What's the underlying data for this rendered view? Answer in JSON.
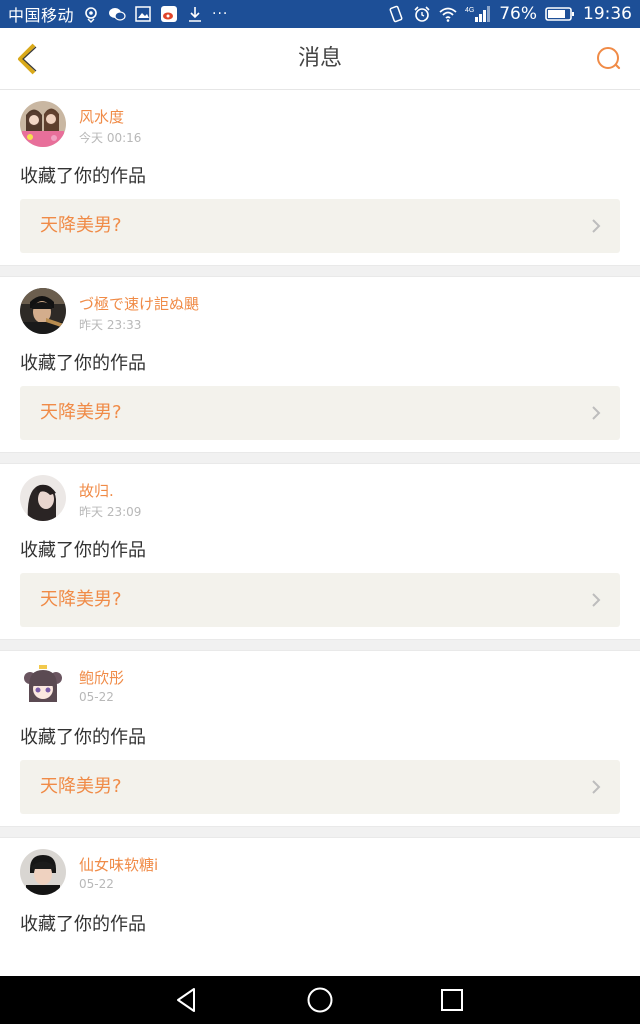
{
  "statusbar": {
    "carrier": "中国移动",
    "network_label": "4G",
    "battery": "76%",
    "time": "19:36",
    "more": "···"
  },
  "header": {
    "title": "消息"
  },
  "colors": {
    "accent": "#f08b47",
    "status_bar": "#1d4f97",
    "card_bg": "#f3f2ec",
    "back_icon": "#e8b91b"
  },
  "icons": {
    "back": "chevron-left-icon",
    "search": "search-icon",
    "card_arrow": "chevron-right-icon",
    "nav_back": "triangle-back-icon",
    "nav_home": "circle-home-icon",
    "nav_recent": "square-recent-icon"
  },
  "messages": [
    {
      "user": "风水度",
      "time": "今天 00:16",
      "action": "收藏了你的作品",
      "work": "天降美男?"
    },
    {
      "user": "づ極で速け詎ぬ颶",
      "time": "昨天 23:33",
      "action": "收藏了你的作品",
      "work": "天降美男?"
    },
    {
      "user": "故归.",
      "time": "昨天 23:09",
      "action": "收藏了你的作品",
      "work": "天降美男?"
    },
    {
      "user": "鲍欣彤",
      "time": "05-22",
      "action": "收藏了你的作品",
      "work": "天降美男?"
    },
    {
      "user": "仙女味软糖i",
      "time": "05-22",
      "action": "收藏了你的作品",
      "work": ""
    }
  ]
}
